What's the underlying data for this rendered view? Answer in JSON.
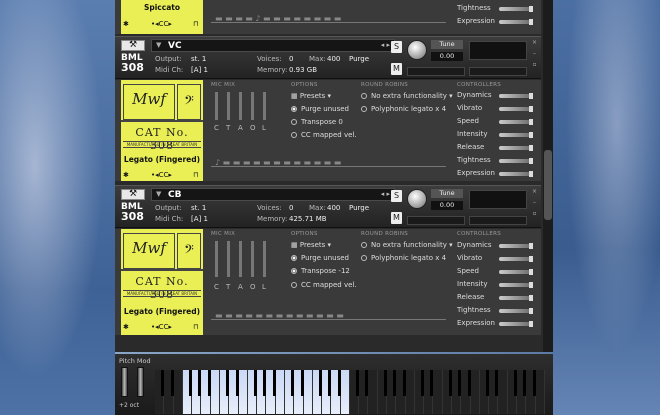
{
  "top_partial": {
    "articulation": "Spiccato",
    "controls": [
      "Tightness",
      "Expression"
    ]
  },
  "instruments": [
    {
      "name": "VC",
      "brand_line1": "BML",
      "brand_line2": "308",
      "output_label": "Output:",
      "output_value": "st. 1",
      "midi_label": "Midi Ch:",
      "midi_value": "[A]  1",
      "voices_label": "Voices:",
      "voices_value": "0",
      "max_label": "Max:",
      "max_value": "400",
      "purge_label": "Purge",
      "memory_label": "Memory:",
      "memory_value": "0.93 GB",
      "solo": "S",
      "mute": "M",
      "tune_label": "Tune",
      "tune_value": "0.00",
      "cat_no": "CAT No. 308",
      "manufactured": "MANUFACTURED IN GREAT BRITAIN",
      "articulation": "Legato (Fingered)",
      "mic_mix_label": "MIC MIX",
      "mic_letters": [
        "C",
        "T",
        "A",
        "O",
        "L"
      ],
      "options_label": "OPTIONS",
      "presets": "Presets",
      "purge_unused": "Purge unused",
      "transpose_label": "Transpose",
      "transpose_value": "0",
      "cc_mapped": "CC mapped vel.",
      "round_robins_label": "ROUND ROBINS",
      "rr1": "No extra functionality",
      "rr2": "Polyphonic legato x 4",
      "controllers_label": "CONTROLLERS",
      "controllers": [
        "Dynamics",
        "Vibrato",
        "Speed",
        "Intensity",
        "Release",
        "Tightness",
        "Expression"
      ]
    },
    {
      "name": "CB",
      "brand_line1": "BML",
      "brand_line2": "308",
      "output_label": "Output:",
      "output_value": "st. 1",
      "midi_label": "Midi Ch:",
      "midi_value": "[A]  1",
      "voices_label": "Voices:",
      "voices_value": "0",
      "max_label": "Max:",
      "max_value": "400",
      "purge_label": "Purge",
      "memory_label": "Memory:",
      "memory_value": "425.71 MB",
      "solo": "S",
      "mute": "M",
      "tune_label": "Tune",
      "tune_value": "0.00",
      "cat_no": "CAT No. 308",
      "manufactured": "MANUFACTURED IN GREAT BRITAIN",
      "articulation": "Legato (Fingered)",
      "mic_mix_label": "MIC MIX",
      "mic_letters": [
        "C",
        "T",
        "A",
        "O",
        "L"
      ],
      "options_label": "OPTIONS",
      "presets": "Presets",
      "purge_unused": "Purge unused",
      "transpose_label": "Transpose",
      "transpose_value": "-12",
      "cc_mapped": "CC mapped vel.",
      "round_robins_label": "ROUND ROBINS",
      "rr1": "No extra functionality",
      "rr2": "Polyphonic legato x 4",
      "controllers_label": "CONTROLLERS",
      "controllers": [
        "Dynamics",
        "Vibrato",
        "Speed",
        "Intensity",
        "Release",
        "Tightness",
        "Expression"
      ]
    }
  ],
  "keyboard": {
    "pitch_mod": "Pitch  Mod",
    "octave": "+2 oct"
  }
}
